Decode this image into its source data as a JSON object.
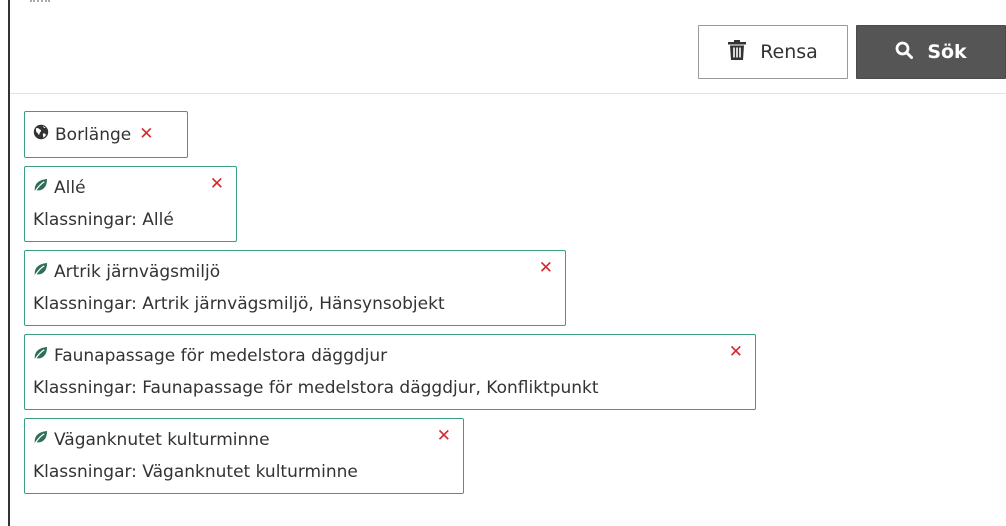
{
  "toolbar": {
    "clear_label": "Rensa",
    "search_label": "Sök"
  },
  "area_filter": {
    "label": "Borlänge",
    "icon": "globe-icon",
    "remove_symbol": "✕"
  },
  "class_filters": [
    {
      "label": "Allé",
      "classifications": "Klassningar: Allé",
      "icon": "leaf-icon",
      "remove_symbol": "✕"
    },
    {
      "label": "Artrik järnvägsmiljö",
      "classifications": "Klassningar: Artrik järnvägsmiljö, Hänsynsobjekt",
      "icon": "leaf-icon",
      "remove_symbol": "✕"
    },
    {
      "label": "Faunapassage för medelstora däggdjur",
      "classifications": "Klassningar: Faunapassage för medelstora däggdjur, Konfliktpunkt",
      "icon": "leaf-icon",
      "remove_symbol": "✕"
    },
    {
      "label": "Väganknutet kulturminne",
      "classifications": "Klassningar: Väganknutet kulturminne",
      "icon": "leaf-icon",
      "remove_symbol": "✕"
    }
  ],
  "colors": {
    "chip_border": "#3a9f82",
    "leaf": "#2f6f5a",
    "remove": "#d9272e",
    "search_button": "#555555"
  }
}
